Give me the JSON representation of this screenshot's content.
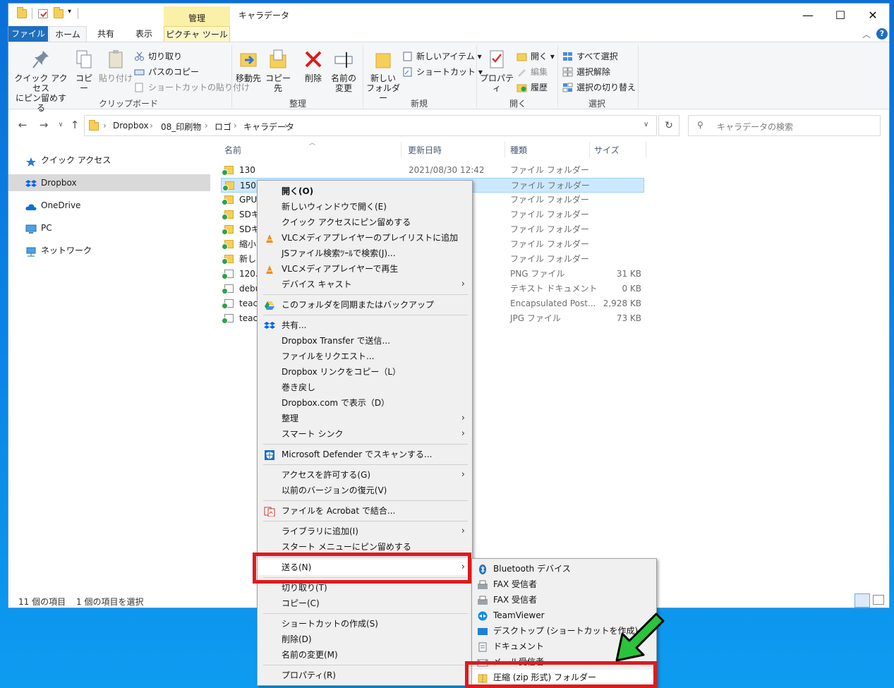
{
  "window": {
    "title": "キャラデータ",
    "manage_tab": "管理",
    "controls": {
      "minimize": "—",
      "maximize": "☐",
      "close": "✕"
    }
  },
  "ribbon_tabs": [
    "ファイル",
    "ホーム",
    "共有",
    "表示",
    "ピクチャ ツール"
  ],
  "ribbon": {
    "clipboard": {
      "pin_line1": "クイック アクセス",
      "pin_line2": "にピン留めする",
      "copy": "コピー",
      "paste": "貼り付け",
      "cut": "切り取り",
      "copy_path": "パスのコピー",
      "paste_shortcut": "ショートカットの貼り付け",
      "label": "クリップボード"
    },
    "organize": {
      "move_to": "移動先",
      "copy_to": "コピー先",
      "delete": "削除",
      "rename_line1": "名前の",
      "rename_line2": "変更",
      "label": "整理"
    },
    "new": {
      "new_folder_line1": "新しい",
      "new_folder_line2": "フォルダー",
      "new_item": "新しいアイテム",
      "shortcut": "ショートカット",
      "label": "新規"
    },
    "open": {
      "properties": "プロパティ",
      "open": "開く",
      "edit": "編集",
      "history": "履歴",
      "label": "開く"
    },
    "select": {
      "select_all": "すべて選択",
      "select_none": "選択解除",
      "invert": "選択の切り替え",
      "label": "選択"
    }
  },
  "address": {
    "crumbs": [
      "Dropbox",
      "08_印刷物",
      "ロゴ",
      "キャラデータ"
    ],
    "search_placeholder": "キャラデータの検索"
  },
  "nav_pane": [
    "クイック アクセス",
    "Dropbox",
    "OneDrive",
    "PC",
    "ネットワーク"
  ],
  "columns": [
    "名前",
    "更新日時",
    "種類",
    "サイズ"
  ],
  "files": [
    {
      "name": "130",
      "date": "2021/08/30 12:42",
      "type": "ファイル フォルダー",
      "size": ""
    },
    {
      "name": "150",
      "date": "",
      "type": "ファイル フォルダー",
      "size": ""
    },
    {
      "name": "GPUC",
      "date": "",
      "type": "ファイル フォルダー",
      "size": ""
    },
    {
      "name": "SDキ",
      "date": "",
      "type": "ファイル フォルダー",
      "size": ""
    },
    {
      "name": "SDキ",
      "date": "",
      "type": "ファイル フォルダー",
      "size": ""
    },
    {
      "name": "縮小",
      "date": "",
      "type": "ファイル フォルダー",
      "size": ""
    },
    {
      "name": "新しい",
      "date": "",
      "type": "ファイル フォルダー",
      "size": ""
    },
    {
      "name": "120.p",
      "date": "",
      "type": "PNG ファイル",
      "size": "31 KB"
    },
    {
      "name": "debu",
      "date": "",
      "type": "テキスト ドキュメント",
      "size": "0 KB"
    },
    {
      "name": "teach",
      "date": "",
      "type": "Encapsulated Post...",
      "size": "2,928 KB"
    },
    {
      "name": "teach",
      "date": "",
      "type": "JPG ファイル",
      "size": "73 KB"
    }
  ],
  "status": {
    "count": "11 個の項目",
    "selected": "1 個の項目を選択"
  },
  "context_menu": [
    "開く(O)",
    "新しいウィンドウで開く(E)",
    "クイック アクセスにピン留めする",
    "VLCメディアプレイヤーのプレイリストに追加",
    "JSファイル検索ﾂｰﾙで検索(J)...",
    "VLCメディアプレイヤーで再生",
    "デバイス キャスト",
    "このフォルダを同期またはバックアップ",
    "共有...",
    "Dropbox Transfer で送信...",
    "ファイルをリクエスト...",
    "Dropbox リンクをコピー（L）",
    "巻き戻し",
    "Dropbox.com で表示（D）",
    "整理",
    "スマート シンク",
    "Microsoft Defender でスキャンする...",
    "アクセスを許可する(G)",
    "以前のバージョンの復元(V)",
    "ファイルを Acrobat で結合...",
    "ライブラリに追加(I)",
    "スタート メニューにピン留めする",
    "送る(N)",
    "切り取り(T)",
    "コピー(C)",
    "ショートカットの作成(S)",
    "削除(D)",
    "名前の変更(M)",
    "プロパティ(R)"
  ],
  "send_to_menu": [
    "Bluetooth デバイス",
    "FAX 受信者",
    "FAX 受信者",
    "TeamViewer",
    "デスクトップ (ショートカットを作成)",
    "ドキュメント",
    "メール受信者",
    "圧縮 (zip 形式) フォルダー"
  ],
  "colors": {
    "highlight": "#e0191d",
    "arrow": "#2bc33c",
    "selection": "#cce8ff",
    "file_tab": "#1e6fbf"
  }
}
